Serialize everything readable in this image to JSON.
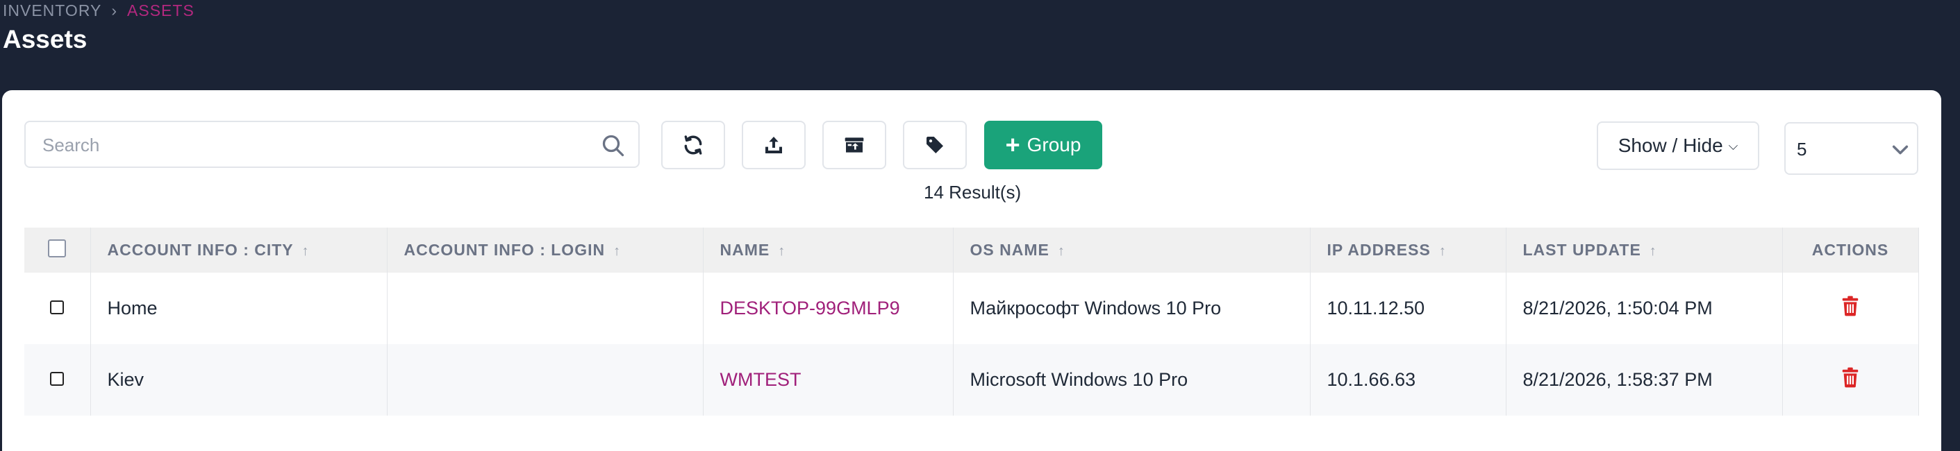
{
  "breadcrumb": {
    "parent": "INVENTORY",
    "separator": "›",
    "current": "ASSETS"
  },
  "page_title": "Assets",
  "toolbar": {
    "search_placeholder": "Search",
    "buttons": [
      "refresh-icon",
      "upload-icon",
      "archive-upload-icon",
      "tag-icon"
    ],
    "group_plus": "+",
    "group_label": "Group",
    "show_hide_label": "Show / Hide",
    "show_hide_chevron": "⌵",
    "per_page_value": "5"
  },
  "results_text": "14 Result(s)",
  "table": {
    "headers": [
      "ACCOUNT INFO : CITY",
      "ACCOUNT INFO : LOGIN",
      "NAME",
      "OS NAME",
      "IP ADDRESS",
      "LAST UPDATE",
      "ACTIONS"
    ],
    "sort_glyph": "↑",
    "rows": [
      {
        "city": "Home",
        "login": "",
        "name": "DESKTOP-99GMLP9",
        "os": "Майкрософт Windows 10 Pro",
        "ip": "10.11.12.50",
        "updated": "8/21/2026, 1:50:04 PM"
      },
      {
        "city": "Kiev",
        "login": "",
        "name": "WMTEST",
        "os": "Microsoft Windows 10 Pro",
        "ip": "10.1.66.63",
        "updated": "8/21/2026, 1:58:37 PM"
      }
    ]
  },
  "colors": {
    "header_bg": "#1b2335",
    "accent_link": "#a0207a",
    "group_button": "#1aa37a",
    "delete_icon": "#dc2626"
  }
}
